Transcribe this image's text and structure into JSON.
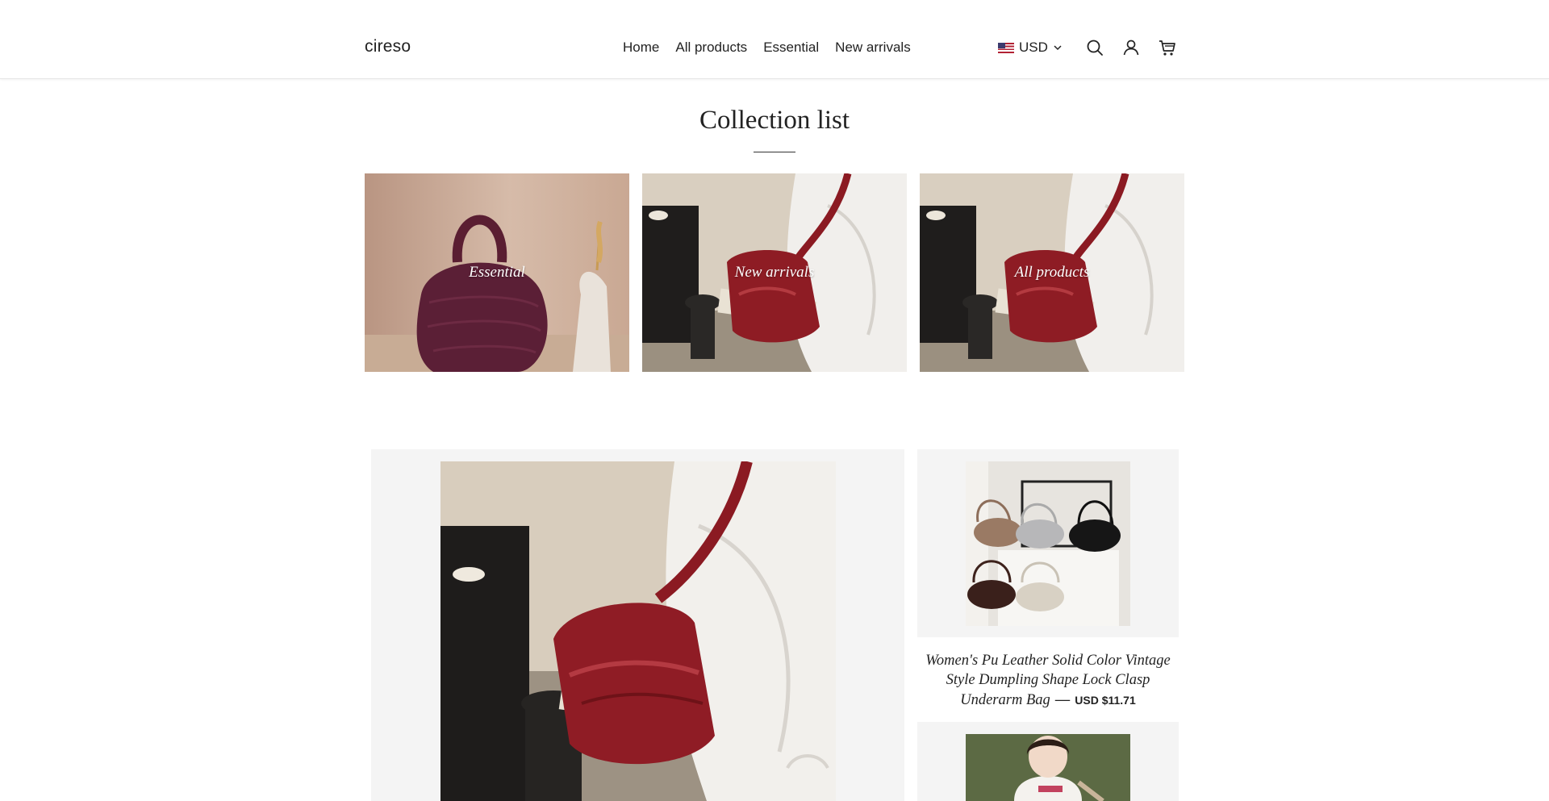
{
  "header": {
    "brand": "cireso",
    "nav": [
      "Home",
      "All products",
      "Essential",
      "New arrivals"
    ],
    "currency": "USD",
    "icons": [
      "us-flag-icon",
      "chevron-down-icon",
      "search-icon",
      "account-icon",
      "cart-icon"
    ]
  },
  "collections": {
    "title": "Collection list",
    "items": [
      {
        "label": "Essential"
      },
      {
        "label": "New arrivals"
      },
      {
        "label": "All products"
      }
    ]
  },
  "products": {
    "side_item": {
      "title": "Women's Pu Leather Solid Color Vintage Style Dumpling Shape Lock Clasp Underarm Bag",
      "separator": "—",
      "price": "USD $11.71"
    }
  },
  "colors": {
    "text": "#222222",
    "panel_bg": "#f4f4f4",
    "divider": "#e6e6e6"
  }
}
